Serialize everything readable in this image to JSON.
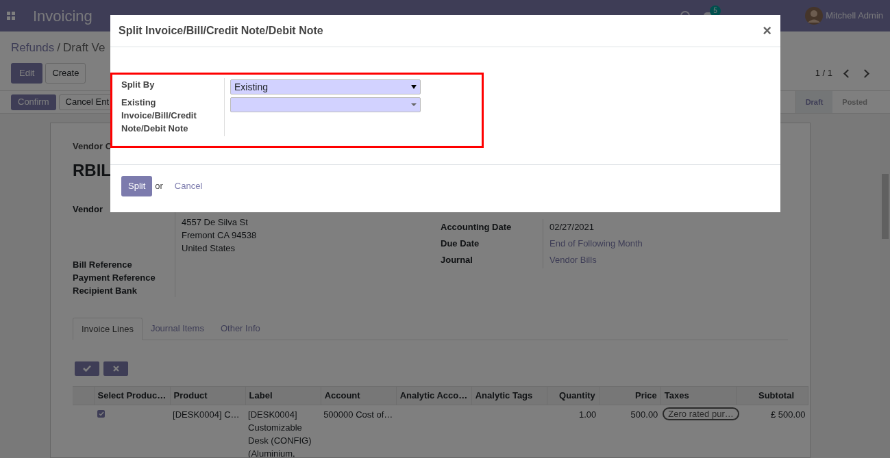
{
  "navbar": {
    "app_title": "Invoicing",
    "message_count": "5",
    "user": "Mitchell Admin"
  },
  "breadcrumb": {
    "items": [
      "Refunds",
      "Draft Ve"
    ],
    "separator": "/"
  },
  "buttons": [
    "Edit",
    "Create"
  ],
  "pager": "1 / 1",
  "action_buttons": [
    "Confirm",
    "Cancel Ent"
  ],
  "statusbar": [
    {
      "label": "Draft",
      "selected": true
    },
    {
      "label": "Posted",
      "selected": false
    }
  ],
  "form": {
    "type_label": "Vendor C",
    "name": "RBIL",
    "vendor": {
      "label": "Vendor",
      "address": [
        "4557 De Silva St",
        "Fremont CA 94538",
        "United States"
      ]
    },
    "left_fields": [
      "Bill Reference",
      "Payment Reference",
      "Recipient Bank"
    ],
    "right_fields": [
      {
        "label": "Accounting Date",
        "value": "02/27/2021",
        "kind": "text"
      },
      {
        "label": "Due Date",
        "value": "End of Following Month",
        "kind": "link"
      },
      {
        "label": "Journal",
        "value": "Vendor Bills",
        "kind": "link"
      }
    ]
  },
  "tabs": [
    {
      "label": "Invoice Lines",
      "selected": true
    },
    {
      "label": "Journal Items",
      "selected": false
    },
    {
      "label": "Other Info",
      "selected": false
    }
  ],
  "table": {
    "columns": [
      "Select Produc…",
      "Product",
      "Label",
      "Account",
      "Analytic Acco…",
      "Analytic Tags",
      "Quantity",
      "Price",
      "Taxes",
      "Subtotal"
    ],
    "rows": [
      {
        "checked": true,
        "product": "[DESK0004] C…",
        "label": "[DESK0004] Customizable Desk (CONFIG) (Aluminium,",
        "account": "500000 Cost of…",
        "quantity": "1.00",
        "price": "500.00",
        "taxes": "Zero rated pur…",
        "subtotal": "£ 500.00"
      }
    ]
  },
  "dialog": {
    "title": "Split Invoice/Bill/Credit Note/Debit Note",
    "close": "×",
    "fields": [
      {
        "label": "Split By",
        "value": "Existing",
        "kind": "select"
      },
      {
        "label": "Existing Invoice/Bill/Credit Note/Debit Note",
        "kind": "many2one"
      }
    ],
    "primary_button": "Split",
    "or_text": "or",
    "cancel_link": "Cancel"
  }
}
